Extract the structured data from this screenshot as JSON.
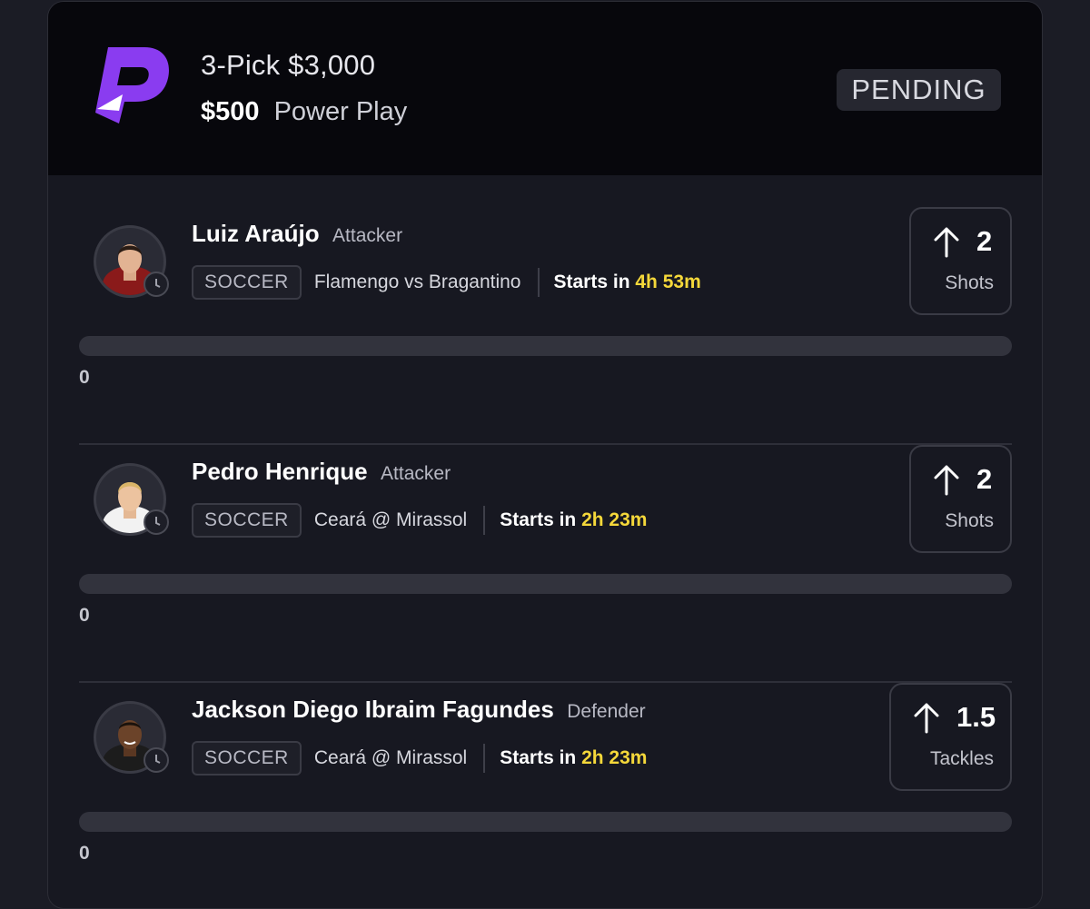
{
  "entry": {
    "title": "3-Pick $3,000",
    "amount": "$500",
    "play_type": "Power Play",
    "status": "PENDING",
    "brand_color": "#8a3cf0"
  },
  "picks": [
    {
      "name": "Luiz Araújo",
      "position": "Attacker",
      "sport": "SOCCER",
      "matchup": "Flamengo vs Bragantino",
      "starts_label": "Starts in",
      "starts_time": "4h 53m",
      "direction": "up-arrow-icon",
      "line": "2",
      "stat": "Shots",
      "progress_value": "0",
      "progress_fraction": 0
    },
    {
      "name": "Pedro Henrique",
      "position": "Attacker",
      "sport": "SOCCER",
      "matchup": "Ceará @ Mirassol",
      "starts_label": "Starts in",
      "starts_time": "2h 23m",
      "direction": "up-arrow-icon",
      "line": "2",
      "stat": "Shots",
      "progress_value": "0",
      "progress_fraction": 0
    },
    {
      "name": "Jackson Diego Ibraim Fagundes",
      "position": "Defender",
      "sport": "SOCCER",
      "matchup": "Ceará @ Mirassol",
      "starts_label": "Starts in",
      "starts_time": "2h 23m",
      "direction": "up-arrow-icon",
      "line": "1.5",
      "stat": "Tackles",
      "progress_value": "0",
      "progress_fraction": 0
    }
  ]
}
